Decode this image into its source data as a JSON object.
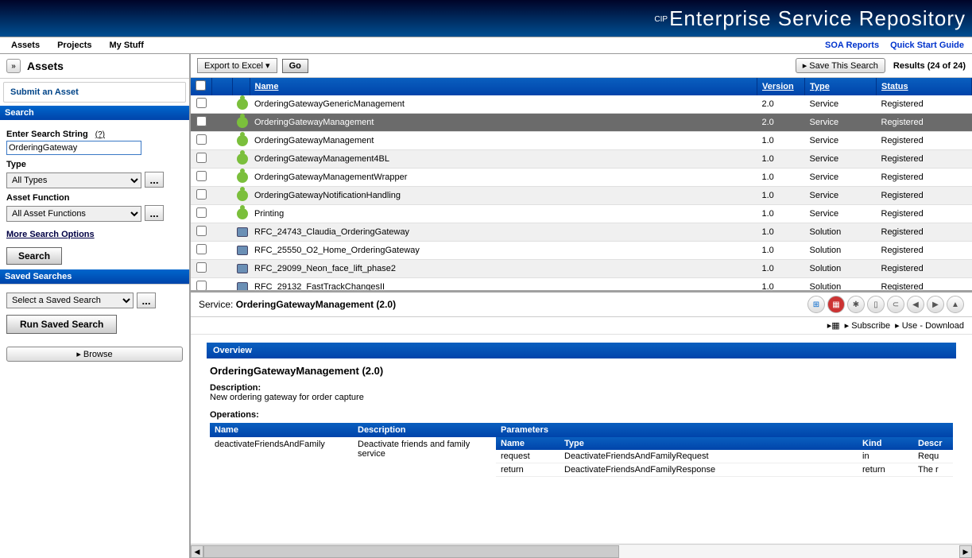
{
  "header": {
    "brand_prefix": "CIP",
    "brand": "Enterprise Service Repository"
  },
  "menubar": {
    "items": [
      "Assets",
      "Projects",
      "My Stuff"
    ],
    "right": [
      {
        "label": "SOA Reports"
      },
      {
        "label": "Quick Start Guide"
      }
    ]
  },
  "sidebar": {
    "title": "Assets",
    "submit_label": "Submit an Asset",
    "search": {
      "title": "Search",
      "string_label": "Enter Search String",
      "hint": "(?)",
      "string_value": "OrderingGateway",
      "type_label": "Type",
      "type_value": "All Types",
      "func_label": "Asset Function",
      "func_value": "All Asset Functions",
      "more_options": "More Search Options",
      "search_btn": "Search"
    },
    "saved": {
      "title": "Saved Searches",
      "select_label": "Select a Saved Search",
      "run_btn": "Run Saved Search"
    },
    "browse_btn": "▸ Browse"
  },
  "toolbar": {
    "export_label": "Export to Excel  ▾",
    "go_label": "Go",
    "save_search_label": "▸ Save This Search",
    "results_label": "Results (24 of 24)"
  },
  "table": {
    "headers": {
      "name": "Name",
      "version": "Version",
      "type": "Type",
      "status": "Status"
    },
    "rows": [
      {
        "name": "OrderingGatewayGenericManagement",
        "version": "2.0",
        "type": "Service",
        "status": "Registered",
        "icon": "svc",
        "selected": false
      },
      {
        "name": "OrderingGatewayManagement",
        "version": "2.0",
        "type": "Service",
        "status": "Registered",
        "icon": "svc",
        "selected": true
      },
      {
        "name": "OrderingGatewayManagement",
        "version": "1.0",
        "type": "Service",
        "status": "Registered",
        "icon": "svc",
        "selected": false
      },
      {
        "name": "OrderingGatewayManagement4BL",
        "version": "1.0",
        "type": "Service",
        "status": "Registered",
        "icon": "svc",
        "selected": false
      },
      {
        "name": "OrderingGatewayManagementWrapper",
        "version": "1.0",
        "type": "Service",
        "status": "Registered",
        "icon": "svc",
        "selected": false
      },
      {
        "name": "OrderingGatewayNotificationHandling",
        "version": "1.0",
        "type": "Service",
        "status": "Registered",
        "icon": "svc",
        "selected": false
      },
      {
        "name": "Printing",
        "version": "1.0",
        "type": "Service",
        "status": "Registered",
        "icon": "svc",
        "selected": false
      },
      {
        "name": "RFC_24743_Claudia_OrderingGateway",
        "version": "1.0",
        "type": "Solution",
        "status": "Registered",
        "icon": "sol",
        "selected": false
      },
      {
        "name": "RFC_25550_O2_Home_OrderingGateway",
        "version": "1.0",
        "type": "Solution",
        "status": "Registered",
        "icon": "sol",
        "selected": false
      },
      {
        "name": "RFC_29099_Neon_face_lift_phase2",
        "version": "1.0",
        "type": "Solution",
        "status": "Registered",
        "icon": "sol",
        "selected": false
      },
      {
        "name": "RFC_29132_FastTrackChangesII",
        "version": "1.0",
        "type": "Solution",
        "status": "Registered",
        "icon": "sol",
        "selected": false
      }
    ]
  },
  "detail": {
    "service_label_prefix": "Service: ",
    "service_name": "OrderingGatewayManagement (2.0)",
    "actions": {
      "subscribe": "▸ Subscribe",
      "use_download": "▸ Use - Download"
    },
    "overview_title": "Overview",
    "asset_title": "OrderingGatewayManagement (2.0)",
    "description_label": "Description:",
    "description_text": "New ordering gateway for order capture",
    "operations_label": "Operations:",
    "op_headers": {
      "name": "Name",
      "description": "Description",
      "parameters": "Parameters"
    },
    "param_headers": {
      "name": "Name",
      "type": "Type",
      "kind": "Kind",
      "descr": "Descr"
    },
    "operations": [
      {
        "name": "deactivateFriendsAndFamily",
        "description": "Deactivate friends and family service",
        "params": [
          {
            "name": "request",
            "type": "DeactivateFriendsAndFamilyRequest",
            "kind": "in",
            "descr": "Requ"
          },
          {
            "name": "return",
            "type": "DeactivateFriendsAndFamilyResponse",
            "kind": "return",
            "descr": "The r"
          }
        ]
      }
    ]
  }
}
